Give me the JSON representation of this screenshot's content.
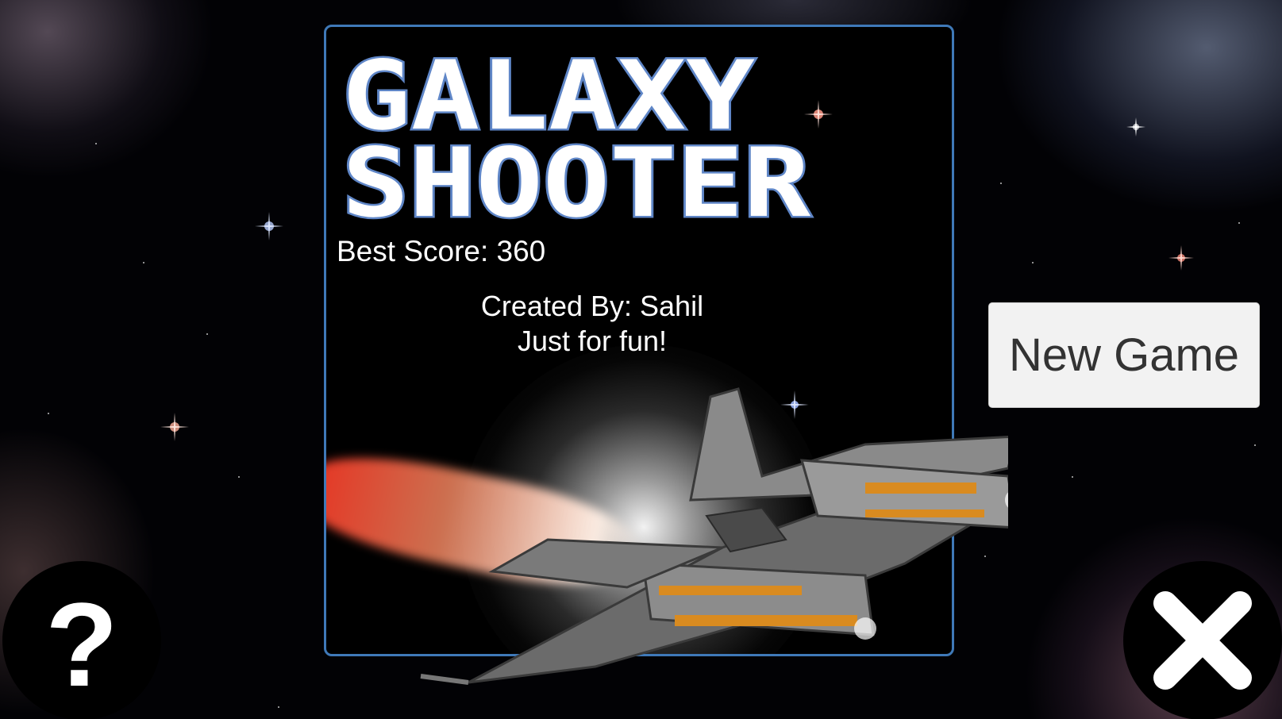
{
  "game": {
    "title_line1": "GALAXY",
    "title_line2": "SHOOTER",
    "best_score_label": "Best Score: 360",
    "credits_line1": "Created By: Sahil",
    "credits_line2": "Just for fun!"
  },
  "buttons": {
    "new_game_label": "New Game",
    "help_label": "?",
    "close_icon": "close-icon"
  },
  "colors": {
    "panel_border": "#3f79b8",
    "title_fill": "#ffffff",
    "title_outline": "#5f86c7",
    "button_bg": "#f2f2f2"
  }
}
